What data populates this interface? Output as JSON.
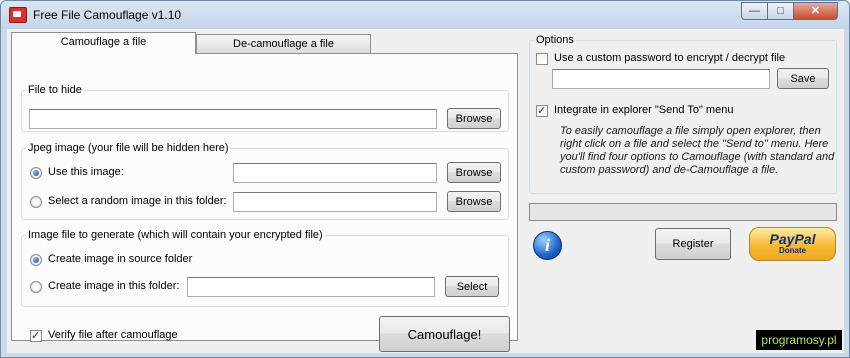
{
  "window": {
    "title": "Free File Camouflage v1.10",
    "minimize_glyph": "—",
    "maximize_glyph": "□",
    "close_glyph": "✕"
  },
  "tabs": {
    "camouflage": "Camouflage a file",
    "decamouflage": "De-camouflage a file"
  },
  "file_to_hide": {
    "legend": "File to hide",
    "path_value": "",
    "browse_label": "Browse"
  },
  "jpeg_image": {
    "legend": "Jpeg image (your file will be hidden here)",
    "use_this_label": "Use this image:",
    "use_this_selected": true,
    "use_this_value": "",
    "use_this_browse": "Browse",
    "random_label": "Select a random image in this folder:",
    "random_value": "",
    "random_browse": "Browse"
  },
  "output": {
    "legend": "Image file to generate (which will contain your encrypted file)",
    "source_folder_label": "Create image in source folder",
    "source_folder_selected": true,
    "this_folder_label": "Create image in this folder:",
    "this_folder_value": "",
    "select_label": "Select"
  },
  "verify": {
    "label": "Verify file after camouflage",
    "checked": true
  },
  "camouflage_button": "Camouflage!",
  "options": {
    "legend": "Options",
    "custom_password_label": "Use a custom password to encrypt / decrypt file",
    "custom_password_checked": false,
    "password_value": "",
    "save_label": "Save",
    "send_to_label": "Integrate in explorer \"Send To\" menu",
    "send_to_checked": true,
    "hint_text": "To easily camouflage a file simply open explorer, then right click on a file and select the \"Send to\" menu. Here you'll find four options to Camouflage (with standard and custom password) and de-Camouflage a file."
  },
  "progress": 0,
  "info_glyph": "i",
  "register_label": "Register",
  "paypal": {
    "brand": "PayPal",
    "action": "Donate"
  },
  "watermark": "programosy.pl",
  "colors": {
    "titlebar": "#c9d9ea",
    "close_button": "#c84a33",
    "radio_selected": "#1c4f99",
    "paypal_gold": "#f7b934",
    "paypal_blue": "#0f2f7a",
    "watermark_bg": "#000000",
    "watermark_text": "#b4e64a"
  }
}
